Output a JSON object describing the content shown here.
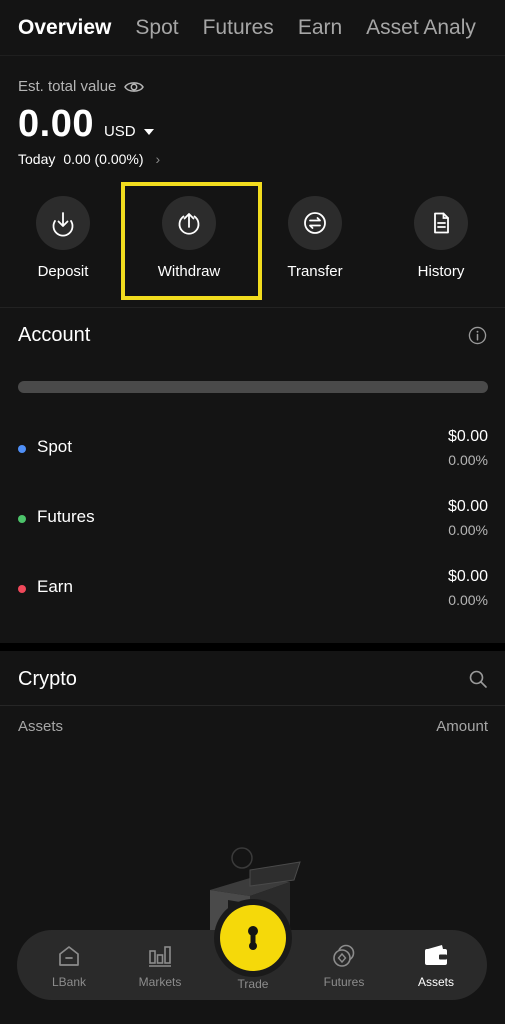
{
  "tabs": [
    "Overview",
    "Spot",
    "Futures",
    "Earn",
    "Asset Analy"
  ],
  "summary": {
    "est_label": "Est. total value",
    "total": "0.00",
    "currency": "USD",
    "today_label": "Today",
    "today_change": "0.00 (0.00%)"
  },
  "actions": {
    "deposit": "Deposit",
    "withdraw": "Withdraw",
    "transfer": "Transfer",
    "history": "History"
  },
  "account": {
    "title": "Account",
    "rows": [
      {
        "name": "Spot",
        "amount": "$0.00",
        "pct": "0.00%",
        "color": "#4f8ff7"
      },
      {
        "name": "Futures",
        "amount": "$0.00",
        "pct": "0.00%",
        "color": "#4cc36a"
      },
      {
        "name": "Earn",
        "amount": "$0.00",
        "pct": "0.00%",
        "color": "#f0485a"
      }
    ]
  },
  "crypto": {
    "title": "Crypto",
    "col_assets": "Assets",
    "col_amount": "Amount"
  },
  "nav": {
    "lbank": "LBank",
    "markets": "Markets",
    "trade": "Trade",
    "futures": "Futures",
    "assets": "Assets"
  },
  "colors": {
    "background": "#141414",
    "accent_yellow": "#f5d90a",
    "highlight": "#f2dc1e"
  },
  "icons": {
    "visibility": "eye-icon",
    "info": "info-icon",
    "search": "search-icon"
  }
}
